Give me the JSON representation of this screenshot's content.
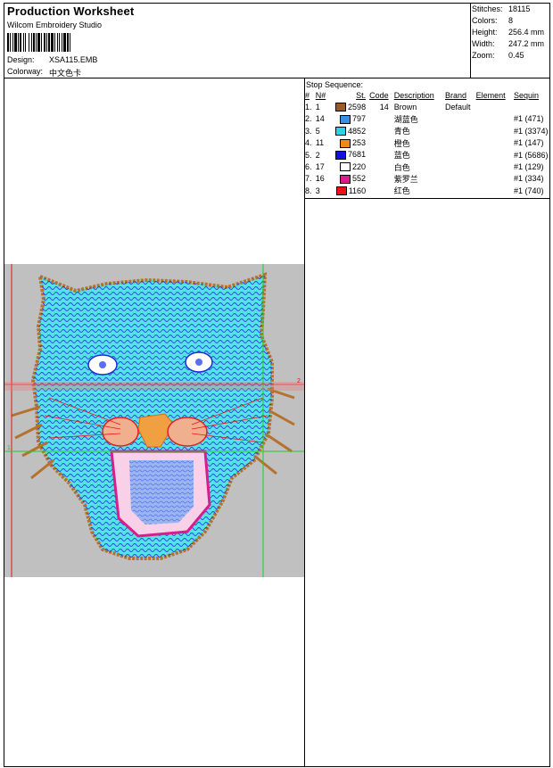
{
  "header": {
    "title": "Production Worksheet",
    "company": "Wilcom  Embroidery Studio",
    "design_label": "Design:",
    "design_value": "XSA115.EMB",
    "colorway_label": "Colorway:",
    "colorway_value": "中文色卡"
  },
  "stats": [
    {
      "label": "Stitches:",
      "value": "18115"
    },
    {
      "label": "Colors:",
      "value": "8"
    },
    {
      "label": "Height:",
      "value": "256.4 mm"
    },
    {
      "label": "Width:",
      "value": "247.2 mm"
    },
    {
      "label": "Zoom:",
      "value": "0.45"
    }
  ],
  "stop_sequence": {
    "title": "Stop Sequence:",
    "columns": [
      "#",
      "N#",
      "St.",
      "Code",
      "Description",
      "Brand",
      "Element",
      "Sequin"
    ],
    "rows": [
      {
        "num": "1.",
        "n": "1",
        "st": "2598",
        "code": "14",
        "desc": "Brown",
        "brand": "Default",
        "element": "",
        "sequin": "",
        "color": "#9a5a2a"
      },
      {
        "num": "2.",
        "n": "14",
        "st": "797",
        "code": "",
        "desc": "湖蓝色",
        "brand": "",
        "element": "",
        "sequin": "#1 (471)",
        "color": "#3a8fe0"
      },
      {
        "num": "3.",
        "n": "5",
        "st": "4852",
        "code": "",
        "desc": "青色",
        "brand": "",
        "element": "",
        "sequin": "#1 (3374)",
        "color": "#2ad4e6"
      },
      {
        "num": "4.",
        "n": "11",
        "st": "253",
        "code": "",
        "desc": "橙色",
        "brand": "",
        "element": "",
        "sequin": "#1 (147)",
        "color": "#f08a1a"
      },
      {
        "num": "5.",
        "n": "2",
        "st": "7681",
        "code": "",
        "desc": "蓝色",
        "brand": "",
        "element": "",
        "sequin": "#1 (5686)",
        "color": "#1010e0"
      },
      {
        "num": "6.",
        "n": "17",
        "st": "220",
        "code": "",
        "desc": "白色",
        "brand": "",
        "element": "",
        "sequin": "#1 (129)",
        "color": "#ffffff"
      },
      {
        "num": "7.",
        "n": "16",
        "st": "552",
        "code": "",
        "desc": "紫罗兰",
        "brand": "",
        "element": "",
        "sequin": "#1 (334)",
        "color": "#d81e8a"
      },
      {
        "num": "8.",
        "n": "3",
        "st": "1160",
        "code": "",
        "desc": "红色",
        "brand": "",
        "element": "",
        "sequin": "#1 (740)",
        "color": "#ee1111"
      }
    ]
  },
  "design_preview": {
    "background": "#c0c0c0",
    "guide_marker_1": "1",
    "guide_marker_2": "2"
  }
}
